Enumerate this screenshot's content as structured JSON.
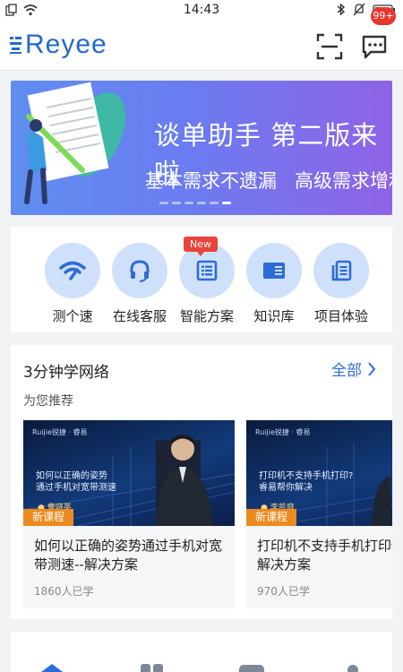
{
  "status_bar": {
    "time": "14:43"
  },
  "header": {
    "logo_text": "Reyee",
    "badge": "99+"
  },
  "banner": {
    "title": "谈单助手 第二版来啦",
    "subtitle": "基本需求不遗漏   高级需求增利润",
    "page_count": 6,
    "active_page": 6
  },
  "quick_actions": {
    "new_tag": "New",
    "items": [
      {
        "label": "测个速",
        "icon": "wifi-speed-icon"
      },
      {
        "label": "在线客服",
        "icon": "headset-icon"
      },
      {
        "label": "智能方案",
        "icon": "document-list-icon"
      },
      {
        "label": "知识库",
        "icon": "book-icon"
      },
      {
        "label": "项目体验",
        "icon": "docs-stack-icon"
      }
    ]
  },
  "learn": {
    "title": "3分钟学网络",
    "all_label": "全部",
    "subtitle": "为您推荐",
    "cards": [
      {
        "thumb_text_1": "如何以正确的姿势",
        "thumb_text_2": "通过手机对宽带测速",
        "thumb_name": "● 曹晓英",
        "tag": "新课程",
        "title": "如何以正确的姿势通过手机对宽带测速--解决方案",
        "count": "1860人已学"
      },
      {
        "thumb_text_1": "打印机不支持手机打印?",
        "thumb_text_2": "睿易帮你解决",
        "thumb_name": "● 李凯庭",
        "tag": "新课程",
        "title": "打印机不支持手机打印你解决--解决方案",
        "count": "970人已学"
      }
    ]
  },
  "colors": {
    "brand": "#2469c9",
    "accent": "#2d6cd6",
    "badge": "#e8372f",
    "tag_new": "#ec8a1f"
  }
}
